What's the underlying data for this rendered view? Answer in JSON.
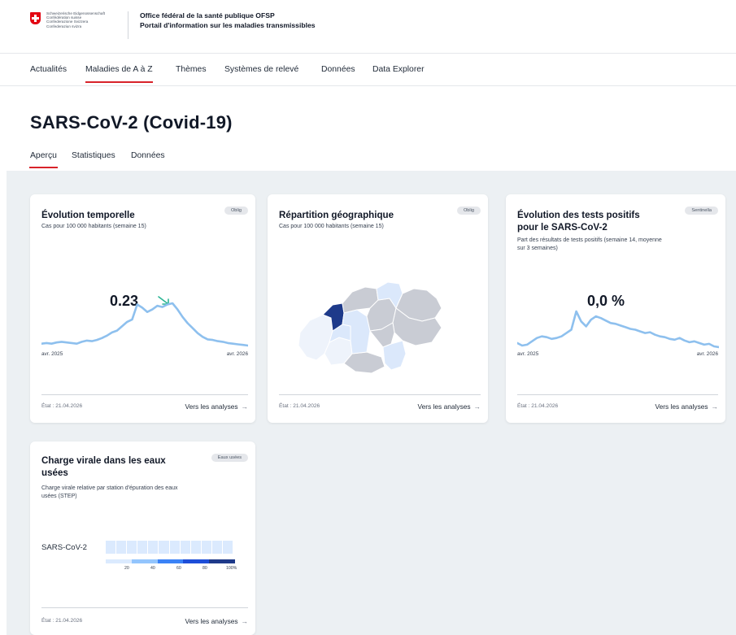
{
  "header": {
    "confederation": [
      "Schweizerische Eidgenossenschaft",
      "Confédération suisse",
      "Confederazione Svizzera",
      "Confederaziun svizra"
    ],
    "org_line1": "Office fédéral de la santé publique OFSP",
    "org_line2": "Portail d'information sur les maladies transmissibles"
  },
  "nav": {
    "items": [
      {
        "label": "Actualités"
      },
      {
        "label": "Maladies de A à Z",
        "active": true
      },
      {
        "label": "Thèmes"
      },
      {
        "label": "Systèmes de relevé"
      },
      {
        "label": "Données"
      },
      {
        "label": "Data Explorer"
      }
    ]
  },
  "page": {
    "title": "SARS-CoV-2 (Covid-19)",
    "tabs": [
      {
        "label": "Aperçu",
        "active": true
      },
      {
        "label": "Statistiques"
      },
      {
        "label": "Données"
      }
    ]
  },
  "cards": {
    "c1": {
      "title": "Évolution temporelle",
      "subtitle": "Cas pour 100 000 habitants (semaine 15)",
      "badge": "Oblig",
      "value": "0.23",
      "x_start": "avr. 2025",
      "x_end": "avr. 2026",
      "state": "État : 21.04.2026",
      "link": "Vers les analyses"
    },
    "c2": {
      "title": "Répartition géographique",
      "subtitle": "Cas pour 100 000 habitants (semaine 15)",
      "badge": "Oblig",
      "state": "État : 21.04.2026",
      "link": "Vers les analyses"
    },
    "c3": {
      "title_line1": "Évolution des tests positifs",
      "title_line2": "pour le SARS-CoV-2",
      "subtitle_line1": "Part des résultats de tests positifs (semaine 14, moyenne",
      "subtitle_line2": "sur 3 semaines)",
      "badge": "Sentinella",
      "value": "0,0 %",
      "x_start": "avr. 2025",
      "x_end": "avr. 2026",
      "state": "État : 21.04.2026",
      "link": "Vers les analyses"
    },
    "c4": {
      "title_line1": "Charge virale dans les eaux",
      "title_line2": "usées",
      "subtitle_line1": "Charge virale relative par station d'épuration des eaux",
      "subtitle_line2": "usées (STEP)",
      "badge": "Eaux usées",
      "row_label": "SARS-CoV-2",
      "legend": [
        "20",
        "40",
        "60",
        "80",
        "100%"
      ],
      "state": "État : 21.04.2026",
      "link": "Vers les analyses"
    }
  },
  "colors": {
    "accent_red": "#d8232a",
    "line_blue": "#8ec0ee",
    "trend_green": "#2bb594",
    "map_grey": "#c9ccd4",
    "map_light": "#dbe8fb",
    "map_pale": "#eef3fb",
    "map_dark": "#1e3a8a"
  },
  "chart_data": [
    {
      "type": "line",
      "x": [
        "avr. 2025",
        "avr. 2026"
      ],
      "values": [
        0.27,
        0.28,
        0.27,
        0.29,
        0.3,
        0.29,
        0.28,
        0.27,
        0.3,
        0.32,
        0.31,
        0.33,
        0.36,
        0.4,
        0.45,
        0.48,
        0.55,
        0.62,
        0.66,
        0.9,
        0.85,
        0.78,
        0.82,
        0.88,
        0.86,
        0.9,
        0.92,
        0.82,
        0.7,
        0.6,
        0.52,
        0.44,
        0.38,
        0.34,
        0.33,
        0.31,
        0.3,
        0.28,
        0.27,
        0.26,
        0.25,
        0.24
      ]
    },
    {
      "type": "line",
      "x": [
        "avr. 2025",
        "avr. 2026"
      ],
      "values": [
        1.8,
        1.5,
        1.6,
        2.0,
        2.4,
        2.6,
        2.5,
        2.3,
        2.4,
        2.6,
        3.0,
        3.4,
        5.6,
        4.4,
        3.8,
        4.6,
        5.0,
        4.8,
        4.5,
        4.2,
        4.1,
        3.9,
        3.7,
        3.5,
        3.4,
        3.2,
        3.0,
        3.1,
        2.8,
        2.6,
        2.5,
        2.3,
        2.2,
        2.4,
        2.1,
        1.9,
        2.0,
        1.8,
        1.6,
        1.7,
        1.4,
        1.3
      ]
    }
  ]
}
